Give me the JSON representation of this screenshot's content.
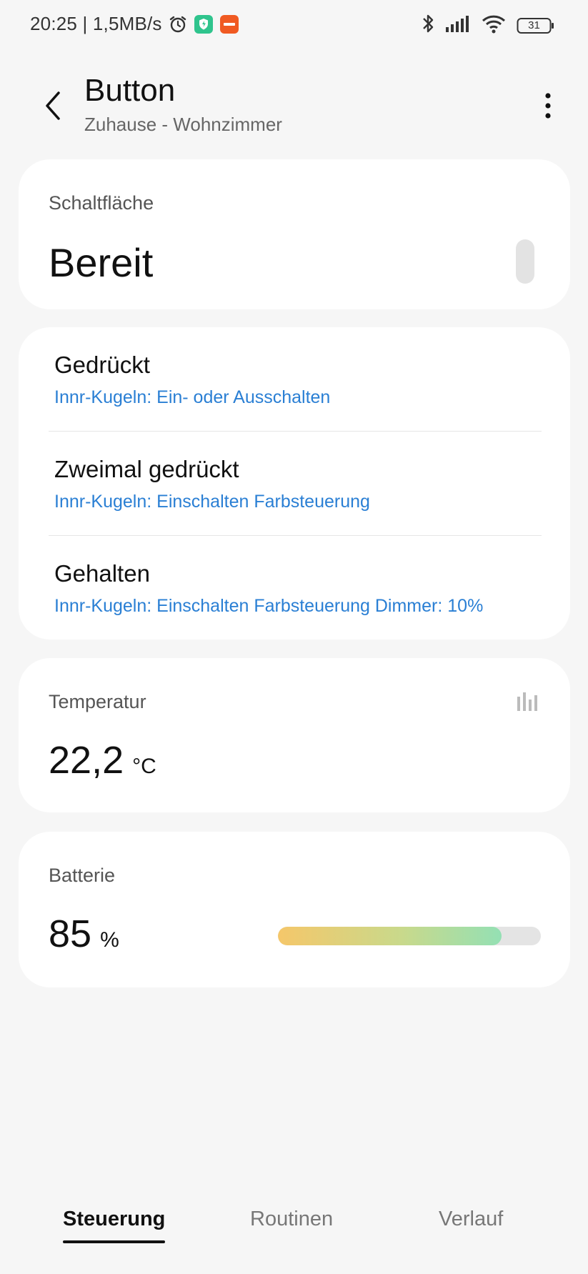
{
  "status_bar": {
    "time_speed": "20:25 | 1,5MB/s",
    "battery": "31",
    "icons": [
      "alarm-icon",
      "shield-app-icon",
      "arte-app-icon",
      "bluetooth-icon",
      "signal-icon",
      "wifi-icon",
      "battery-icon"
    ]
  },
  "header": {
    "title": "Button",
    "subtitle": "Zuhause - Wohnzimmer"
  },
  "button_card": {
    "label": "Schaltfläche",
    "state": "Bereit"
  },
  "actions": [
    {
      "title": "Gedrückt",
      "description": "Innr-Kugeln: Ein- oder Ausschalten"
    },
    {
      "title": "Zweimal gedrückt",
      "description": "Innr-Kugeln: Einschalten Farbsteuerung"
    },
    {
      "title": "Gehalten",
      "description": "Innr-Kugeln: Einschalten Farbsteuerung Dimmer: 10%"
    }
  ],
  "temperature": {
    "label": "Temperatur",
    "value": "22,2",
    "unit": "°C"
  },
  "battery": {
    "label": "Batterie",
    "value": "85",
    "unit": "%",
    "fraction": 0.85
  },
  "tabs": [
    {
      "label": "Steuerung",
      "active": true
    },
    {
      "label": "Routinen",
      "active": false
    },
    {
      "label": "Verlauf",
      "active": false
    }
  ],
  "colors": {
    "link": "#2a7fd4",
    "background": "#f6f6f6",
    "card": "#ffffff"
  }
}
